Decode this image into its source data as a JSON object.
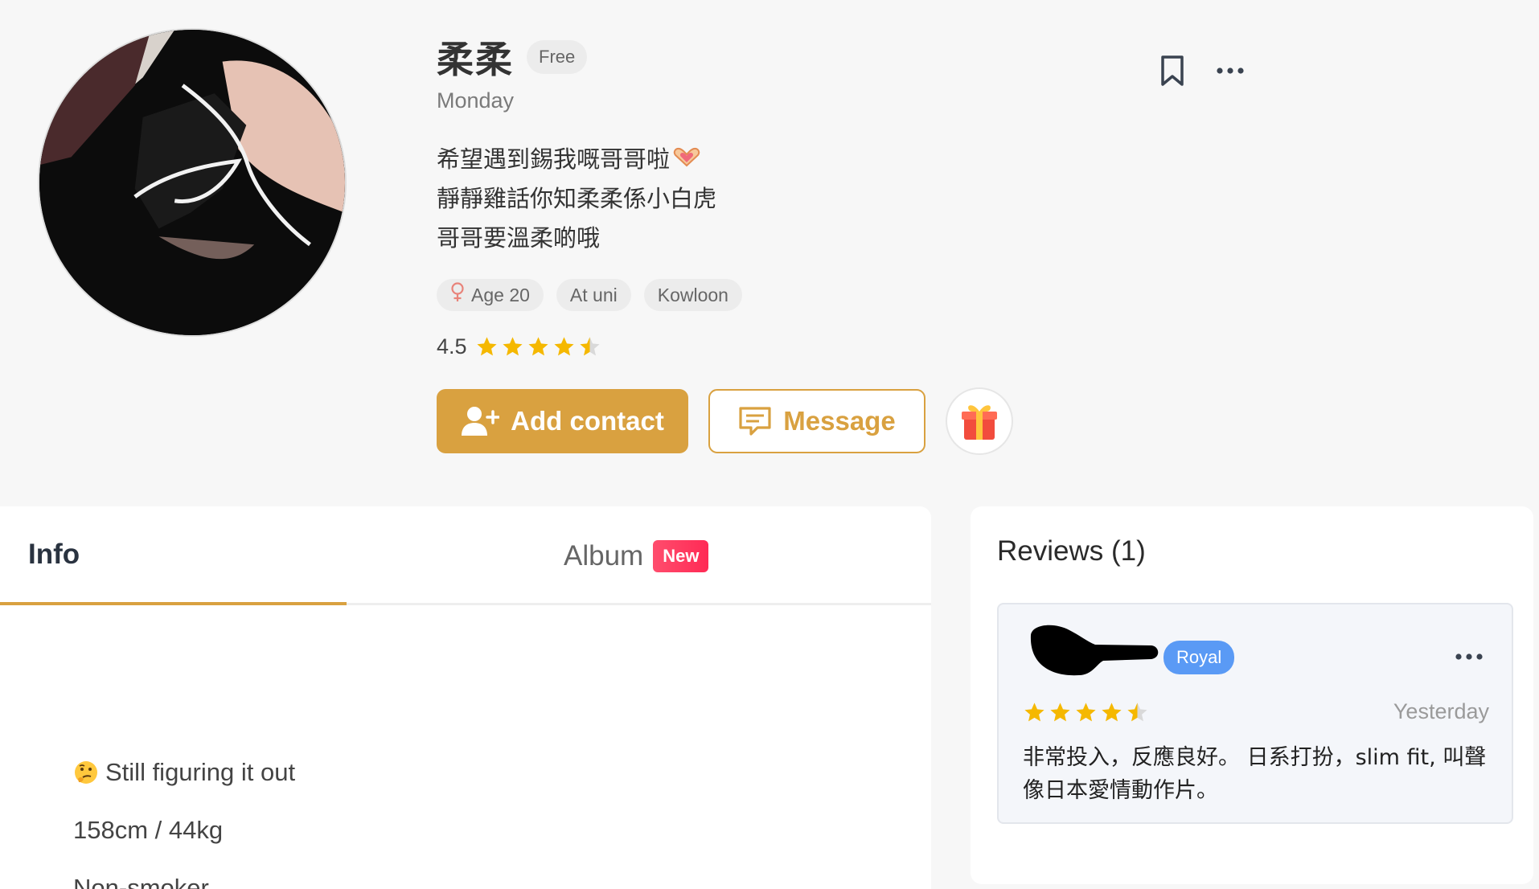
{
  "profile": {
    "name": "柔柔",
    "tier": "Free",
    "subtitle": "Monday",
    "bio_lines": [
      "希望遇到錫我嘅哥哥啦",
      "靜靜雞話你知柔柔係小白虎",
      "哥哥要溫柔啲哦"
    ],
    "tags": [
      "Age 20",
      "At uni",
      "Kowloon"
    ],
    "rating": "4.5"
  },
  "actions": {
    "add_contact": "Add contact",
    "message": "Message"
  },
  "tabs": {
    "info": "Info",
    "album": "Album",
    "album_badge": "New"
  },
  "info": {
    "items": [
      "Still figuring it out",
      "158cm / 44kg",
      "Non-smoker"
    ]
  },
  "reviews": {
    "title": "Reviews (1)",
    "items": [
      {
        "badge": "Royal",
        "date": "Yesterday",
        "text": "非常投入，反應良好。 日系打扮，slim fit, 叫聲像日本愛情動作片。"
      }
    ]
  },
  "colors": {
    "accent": "#d9a140",
    "star": "#f5b800",
    "royal": "#5a9af5",
    "new_badge": "#ff2a55",
    "female_icon": "#e8837a"
  },
  "icons": [
    "bookmark-icon",
    "more-icon",
    "add-user-icon",
    "message-icon",
    "gift-icon",
    "female-icon",
    "star-icon",
    "thinking-emoji-icon",
    "heart-hands-emoji-icon"
  ]
}
